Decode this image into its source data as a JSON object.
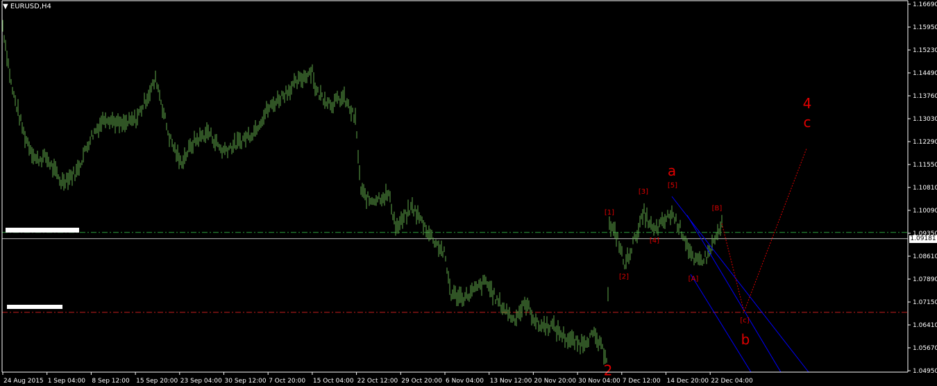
{
  "window": {
    "symbol_timeframe": "EURUSD,H4"
  },
  "current_price": "1.09181",
  "price_axis": {
    "ticks": [
      "1.16690",
      "1.15950",
      "1.15230",
      "1.14490",
      "1.13760",
      "1.13030",
      "1.12290",
      "1.11550",
      "1.10810",
      "1.10090",
      "1.09350",
      "1.08610",
      "1.07890",
      "1.07150",
      "1.06410",
      "1.05670",
      "1.04950"
    ]
  },
  "time_axis": {
    "ticks": [
      "24 Aug 2015",
      "1 Sep 04:00",
      "8 Sep 12:00",
      "15 Sep 20:00",
      "23 Sep 04:00",
      "30 Sep 12:00",
      "7 Oct 20:00",
      "15 Oct 04:00",
      "22 Oct 12:00",
      "29 Oct 20:00",
      "6 Nov 04:00",
      "13 Nov 12:00",
      "20 Nov 20:00",
      "30 Nov 04:00",
      "7 Dec 12:00",
      "14 Dec 20:00",
      "22 Dec 04:00"
    ]
  },
  "levels": {
    "green_line": 1.0938,
    "red_line": 1.0682,
    "current_line": 1.09181
  },
  "wave_labels": [
    {
      "text": "[1]",
      "price": 1.0995,
      "bar": 878
    },
    {
      "text": "[2]",
      "price": 1.079,
      "bar": 899
    },
    {
      "text": "[3]",
      "price": 1.1062,
      "bar": 927
    },
    {
      "text": "[4]",
      "price": 1.0905,
      "bar": 943
    },
    {
      "text": "[5]",
      "price": 1.1082,
      "bar": 969
    },
    {
      "text": "[A]",
      "price": 1.0783,
      "bar": 999
    },
    {
      "text": "[B]",
      "price": 1.1009,
      "bar": 1033
    },
    {
      "text": "[c]",
      "price": 1.065,
      "bar": 1073
    },
    {
      "text": "a",
      "price": 1.112,
      "bar": 968,
      "big": true
    },
    {
      "text": "b",
      "price": 1.058,
      "bar": 1074,
      "big": true
    },
    {
      "text": "4",
      "price": 1.1335,
      "bar": 1163,
      "big": true
    },
    {
      "text": "c",
      "price": 1.1275,
      "bar": 1163,
      "big": true
    },
    {
      "text": "2",
      "price": 1.048,
      "bar": 876,
      "big": true
    }
  ],
  "colors": {
    "background": "#000000",
    "bars": "#5fa84a",
    "axis": "#ffffff",
    "wave": "#e10000",
    "channel": "#0000ff",
    "green_level": "#2a9d3c",
    "red_level": "#c81e1e"
  },
  "chart_data": {
    "type": "bar",
    "symbol": "EURUSD",
    "timeframe": "H4",
    "ylim": [
      1.0495,
      1.1669
    ],
    "path": [
      {
        "x": "24 Aug 2015",
        "y": 1.16
      },
      {
        "x": "25 Aug 2015",
        "y": 1.14
      },
      {
        "x": "28 Aug 2015",
        "y": 1.125
      },
      {
        "x": "30 Aug 2015",
        "y": 1.117
      },
      {
        "x": "1 Sep 04:00",
        "y": 1.118
      },
      {
        "x": "3 Sep 2015",
        "y": 1.11
      },
      {
        "x": "5 Sep 2015",
        "y": 1.113
      },
      {
        "x": "8 Sep 12:00",
        "y": 1.124
      },
      {
        "x": "10 Sep 2015",
        "y": 1.131
      },
      {
        "x": "13 Sep 2015",
        "y": 1.128
      },
      {
        "x": "15 Sep 20:00",
        "y": 1.13
      },
      {
        "x": "17 Sep 2015",
        "y": 1.143
      },
      {
        "x": "19 Sep 2015",
        "y": 1.125
      },
      {
        "x": "23 Sep 04:00",
        "y": 1.116
      },
      {
        "x": "25 Sep 2015",
        "y": 1.123
      },
      {
        "x": "28 Sep 2015",
        "y": 1.126
      },
      {
        "x": "30 Sep 12:00",
        "y": 1.12
      },
      {
        "x": "2 Oct 2015",
        "y": 1.122
      },
      {
        "x": "5 Oct 2015",
        "y": 1.126
      },
      {
        "x": "7 Oct 20:00",
        "y": 1.133
      },
      {
        "x": "11 Oct 2015",
        "y": 1.138
      },
      {
        "x": "14 Oct 2015",
        "y": 1.146
      },
      {
        "x": "15 Oct 04:00",
        "y": 1.139
      },
      {
        "x": "18 Oct 2015",
        "y": 1.135
      },
      {
        "x": "20 Oct 2015",
        "y": 1.137
      },
      {
        "x": "22 Oct 12:00",
        "y": 1.13
      },
      {
        "x": "23 Oct 2015",
        "y": 1.107
      },
      {
        "x": "26 Oct 2015",
        "y": 1.104
      },
      {
        "x": "28 Oct 2015",
        "y": 1.106
      },
      {
        "x": "29 Oct 20:00",
        "y": 1.095
      },
      {
        "x": "2 Nov 2015",
        "y": 1.102
      },
      {
        "x": "4 Nov 2015",
        "y": 1.093
      },
      {
        "x": "6 Nov 04:00",
        "y": 1.087
      },
      {
        "x": "8 Nov 2015",
        "y": 1.074
      },
      {
        "x": "11 Nov 2015",
        "y": 1.073
      },
      {
        "x": "12 Nov 2015",
        "y": 1.078
      },
      {
        "x": "13 Nov 12:00",
        "y": 1.072
      },
      {
        "x": "17 Nov 2015",
        "y": 1.066
      },
      {
        "x": "19 Nov 2015",
        "y": 1.071
      },
      {
        "x": "20 Nov 20:00",
        "y": 1.064
      },
      {
        "x": "24 Nov 2015",
        "y": 1.064
      },
      {
        "x": "26 Nov 2015",
        "y": 1.06
      },
      {
        "x": "28 Nov 2015",
        "y": 1.058
      },
      {
        "x": "30 Nov 04:00",
        "y": 1.061
      },
      {
        "x": "3 Dec 2015",
        "y": 1.054
      },
      {
        "x": "3 Dec 2015 b",
        "y": 1.096
      },
      {
        "x": "4 Dec 2015",
        "y": 1.092
      },
      {
        "x": "7 Dec 12:00",
        "y": 1.083
      },
      {
        "x": "9 Dec 2015",
        "y": 1.1
      },
      {
        "x": "10 Dec 2015",
        "y": 1.094
      },
      {
        "x": "14 Dec 20:00",
        "y": 1.1
      },
      {
        "x": "16 Dec 2015",
        "y": 1.093
      },
      {
        "x": "18 Dec 2015",
        "y": 1.084
      },
      {
        "x": "21 Dec 2015",
        "y": 1.086
      },
      {
        "x": "22 Dec 04:00",
        "y": 1.096
      }
    ]
  }
}
